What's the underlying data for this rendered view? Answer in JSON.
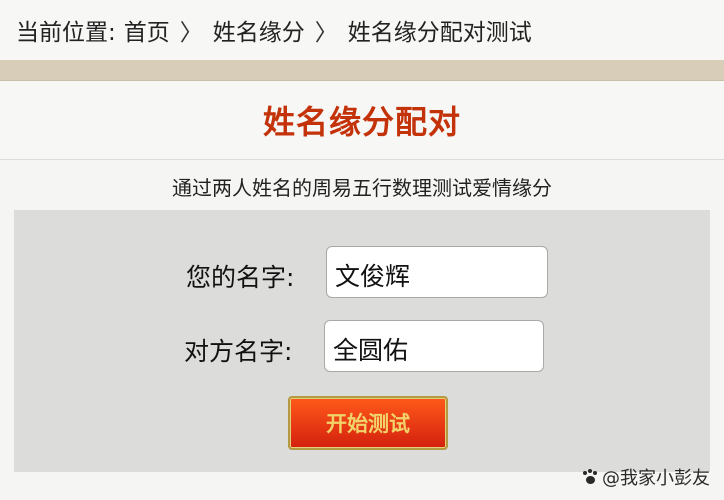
{
  "breadcrumb": {
    "prefix": "当前位置:",
    "items": [
      "首页",
      "姓名缘分",
      "姓名缘分配对测试"
    ],
    "separator": "〉"
  },
  "page": {
    "title": "姓名缘分配对",
    "subtitle": "通过两人姓名的周易五行数理测试爱情缘分"
  },
  "form": {
    "your_name_label": "您的名字:",
    "your_name_value": "文俊辉",
    "other_name_label": "对方名字:",
    "other_name_value": "全圆佑",
    "start_button": "开始测试"
  },
  "watermark": {
    "text": "@我家小彭友"
  },
  "colors": {
    "title": "#c4320a",
    "button_top": "#ff5a1a",
    "button_bottom": "#d3200e",
    "button_text": "#f1d36a"
  }
}
